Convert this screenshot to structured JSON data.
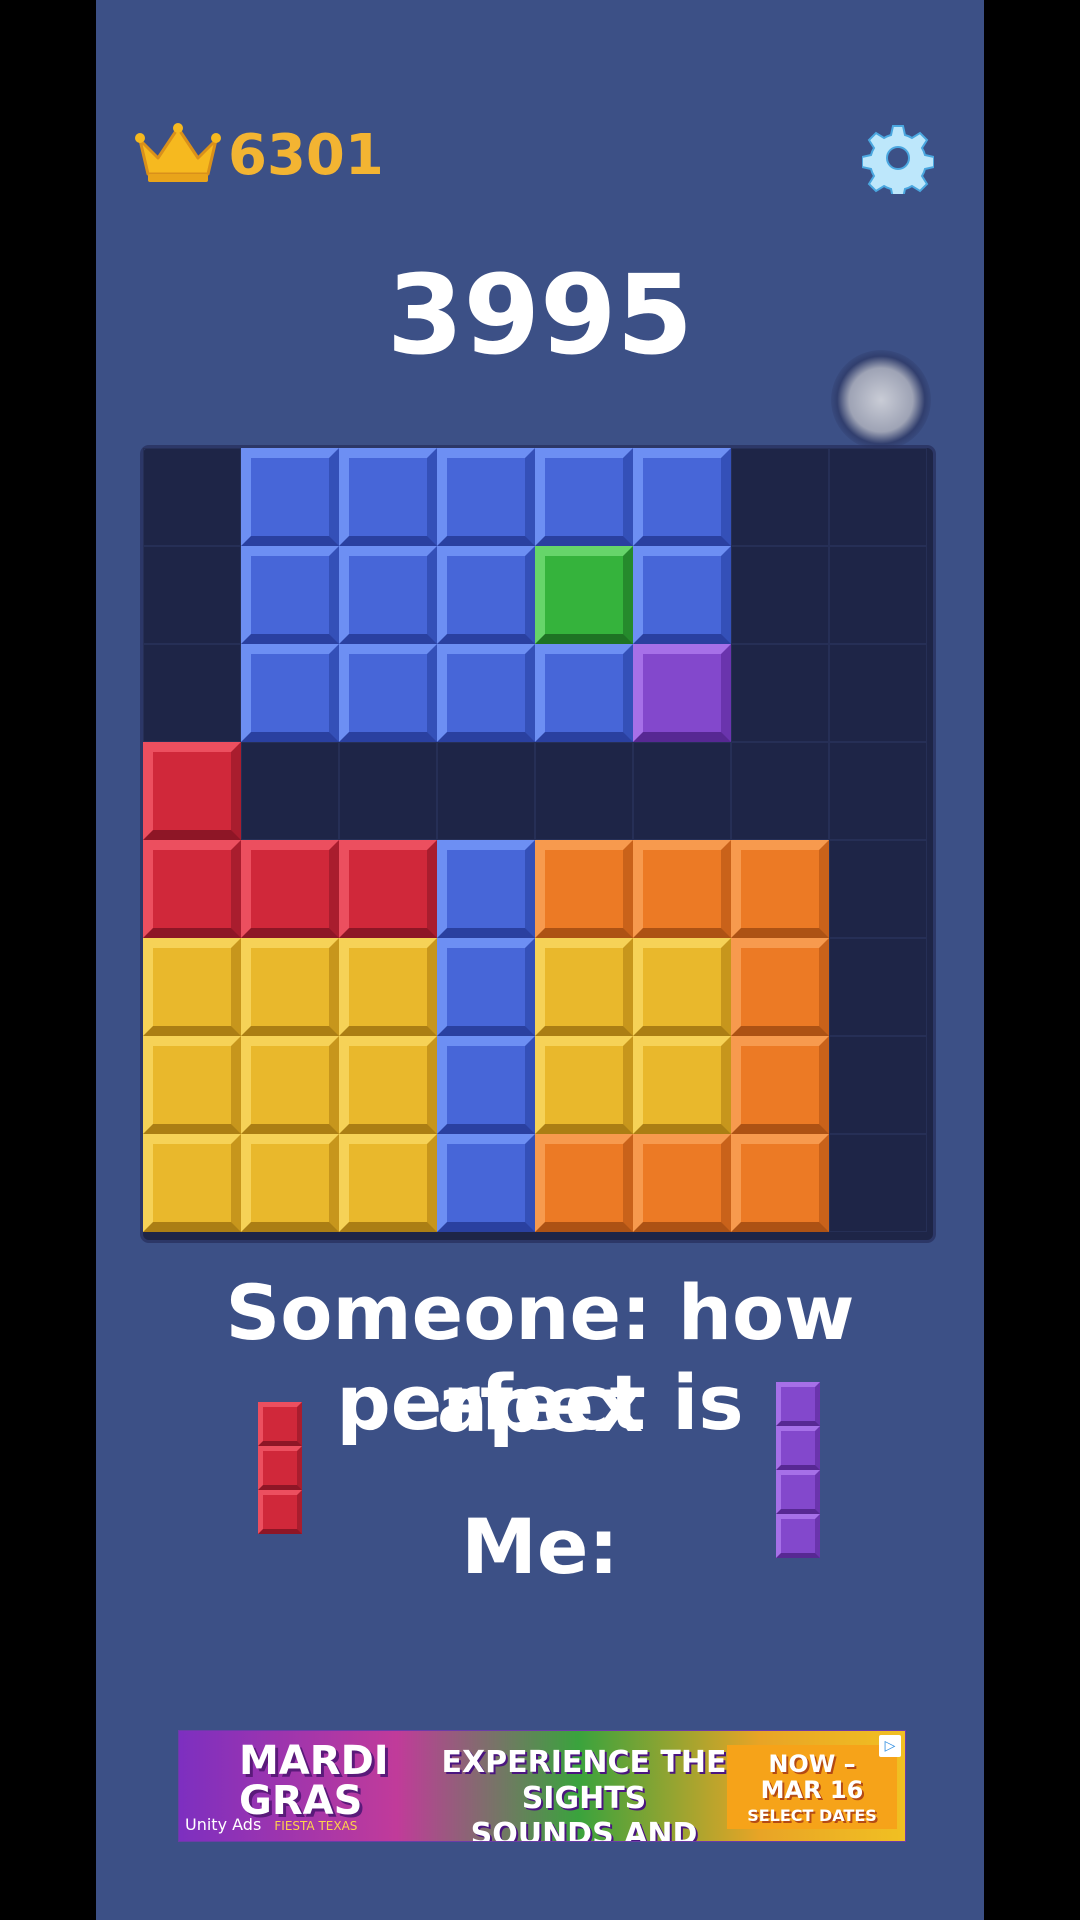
{
  "header": {
    "best_score": "6301",
    "score": "3995"
  },
  "icons": {
    "best": "crown-icon",
    "settings": "gear-icon"
  },
  "colors": {
    "blue": {
      "m": "#4766d8",
      "l": "#6d8ff3",
      "r": "#3450b8",
      "b": "#2a40a0"
    },
    "green": {
      "m": "#35b33c",
      "l": "#66d56a",
      "r": "#258a2c",
      "b": "#1e7324"
    },
    "purple": {
      "m": "#8348cc",
      "l": "#a670e8",
      "r": "#6a34ad",
      "b": "#572893"
    },
    "red": {
      "m": "#d0283a",
      "l": "#ec4f5f",
      "r": "#a91d2e",
      "b": "#8e1626"
    },
    "orange": {
      "m": "#ec7a25",
      "l": "#f79a4e",
      "r": "#c9621a",
      "b": "#ad5214"
    },
    "yellow": {
      "m": "#e9b82c",
      "l": "#f6d257",
      "r": "#c7961c",
      "b": "#ab7e14"
    }
  },
  "board": {
    "rows": 8,
    "cols": 8,
    "grid": [
      [
        ".",
        "B",
        "B",
        "B",
        "B",
        "B",
        ".",
        "."
      ],
      [
        ".",
        "B",
        "B",
        "B",
        "G",
        "B",
        ".",
        "."
      ],
      [
        ".",
        "B",
        "B",
        "B",
        "B",
        "P",
        ".",
        "."
      ],
      [
        "R",
        ".",
        ".",
        ".",
        ".",
        ".",
        ".",
        "."
      ],
      [
        "R",
        "R",
        "R",
        "B",
        "O",
        "O",
        "O",
        "."
      ],
      [
        "Y",
        "Y",
        "Y",
        "B",
        "Y",
        "Y",
        "O",
        "."
      ],
      [
        "Y",
        "Y",
        "Y",
        "B",
        "Y",
        "Y",
        "O",
        "."
      ],
      [
        "Y",
        "Y",
        "Y",
        "B",
        "O",
        "O",
        "O",
        "."
      ]
    ],
    "legend": {
      "B": "blue",
      "G": "green",
      "P": "purple",
      "R": "red",
      "O": "orange",
      "Y": "yellow"
    }
  },
  "tray": [
    {
      "color": "red",
      "cells": 3
    },
    {
      "color": "purple",
      "cells": 4
    }
  ],
  "caption": {
    "line1": "Someone: how perfect is",
    "line2": "apex",
    "line3": "Me:"
  },
  "ad": {
    "title_line1": "MARDI",
    "title_line2": "GRAS",
    "tagline_line1": "EXPERIENCE THE SIGHTS",
    "tagline_line2": "SOUNDS AND TASTES",
    "dates_line1": "NOW –",
    "dates_line2": "MAR 16",
    "dates_line3": "SELECT DATES",
    "provider": "Unity Ads",
    "venue": "FIESTA TEXAS"
  }
}
